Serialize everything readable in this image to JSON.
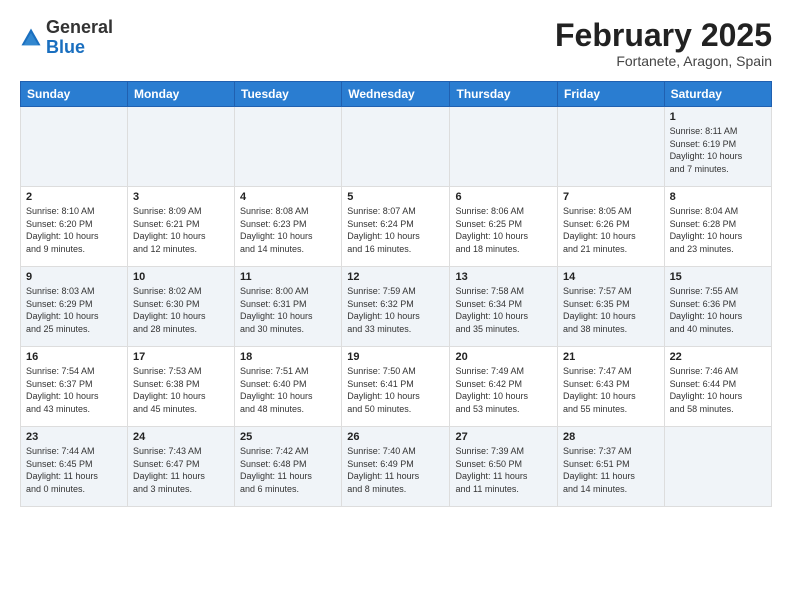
{
  "header": {
    "logo_general": "General",
    "logo_blue": "Blue",
    "title": "February 2025",
    "subtitle": "Fortanete, Aragon, Spain"
  },
  "weekdays": [
    "Sunday",
    "Monday",
    "Tuesday",
    "Wednesday",
    "Thursday",
    "Friday",
    "Saturday"
  ],
  "weeks": [
    [
      {
        "day": "",
        "info": ""
      },
      {
        "day": "",
        "info": ""
      },
      {
        "day": "",
        "info": ""
      },
      {
        "day": "",
        "info": ""
      },
      {
        "day": "",
        "info": ""
      },
      {
        "day": "",
        "info": ""
      },
      {
        "day": "1",
        "info": "Sunrise: 8:11 AM\nSunset: 6:19 PM\nDaylight: 10 hours\nand 7 minutes."
      }
    ],
    [
      {
        "day": "2",
        "info": "Sunrise: 8:10 AM\nSunset: 6:20 PM\nDaylight: 10 hours\nand 9 minutes."
      },
      {
        "day": "3",
        "info": "Sunrise: 8:09 AM\nSunset: 6:21 PM\nDaylight: 10 hours\nand 12 minutes."
      },
      {
        "day": "4",
        "info": "Sunrise: 8:08 AM\nSunset: 6:23 PM\nDaylight: 10 hours\nand 14 minutes."
      },
      {
        "day": "5",
        "info": "Sunrise: 8:07 AM\nSunset: 6:24 PM\nDaylight: 10 hours\nand 16 minutes."
      },
      {
        "day": "6",
        "info": "Sunrise: 8:06 AM\nSunset: 6:25 PM\nDaylight: 10 hours\nand 18 minutes."
      },
      {
        "day": "7",
        "info": "Sunrise: 8:05 AM\nSunset: 6:26 PM\nDaylight: 10 hours\nand 21 minutes."
      },
      {
        "day": "8",
        "info": "Sunrise: 8:04 AM\nSunset: 6:28 PM\nDaylight: 10 hours\nand 23 minutes."
      }
    ],
    [
      {
        "day": "9",
        "info": "Sunrise: 8:03 AM\nSunset: 6:29 PM\nDaylight: 10 hours\nand 25 minutes."
      },
      {
        "day": "10",
        "info": "Sunrise: 8:02 AM\nSunset: 6:30 PM\nDaylight: 10 hours\nand 28 minutes."
      },
      {
        "day": "11",
        "info": "Sunrise: 8:00 AM\nSunset: 6:31 PM\nDaylight: 10 hours\nand 30 minutes."
      },
      {
        "day": "12",
        "info": "Sunrise: 7:59 AM\nSunset: 6:32 PM\nDaylight: 10 hours\nand 33 minutes."
      },
      {
        "day": "13",
        "info": "Sunrise: 7:58 AM\nSunset: 6:34 PM\nDaylight: 10 hours\nand 35 minutes."
      },
      {
        "day": "14",
        "info": "Sunrise: 7:57 AM\nSunset: 6:35 PM\nDaylight: 10 hours\nand 38 minutes."
      },
      {
        "day": "15",
        "info": "Sunrise: 7:55 AM\nSunset: 6:36 PM\nDaylight: 10 hours\nand 40 minutes."
      }
    ],
    [
      {
        "day": "16",
        "info": "Sunrise: 7:54 AM\nSunset: 6:37 PM\nDaylight: 10 hours\nand 43 minutes."
      },
      {
        "day": "17",
        "info": "Sunrise: 7:53 AM\nSunset: 6:38 PM\nDaylight: 10 hours\nand 45 minutes."
      },
      {
        "day": "18",
        "info": "Sunrise: 7:51 AM\nSunset: 6:40 PM\nDaylight: 10 hours\nand 48 minutes."
      },
      {
        "day": "19",
        "info": "Sunrise: 7:50 AM\nSunset: 6:41 PM\nDaylight: 10 hours\nand 50 minutes."
      },
      {
        "day": "20",
        "info": "Sunrise: 7:49 AM\nSunset: 6:42 PM\nDaylight: 10 hours\nand 53 minutes."
      },
      {
        "day": "21",
        "info": "Sunrise: 7:47 AM\nSunset: 6:43 PM\nDaylight: 10 hours\nand 55 minutes."
      },
      {
        "day": "22",
        "info": "Sunrise: 7:46 AM\nSunset: 6:44 PM\nDaylight: 10 hours\nand 58 minutes."
      }
    ],
    [
      {
        "day": "23",
        "info": "Sunrise: 7:44 AM\nSunset: 6:45 PM\nDaylight: 11 hours\nand 0 minutes."
      },
      {
        "day": "24",
        "info": "Sunrise: 7:43 AM\nSunset: 6:47 PM\nDaylight: 11 hours\nand 3 minutes."
      },
      {
        "day": "25",
        "info": "Sunrise: 7:42 AM\nSunset: 6:48 PM\nDaylight: 11 hours\nand 6 minutes."
      },
      {
        "day": "26",
        "info": "Sunrise: 7:40 AM\nSunset: 6:49 PM\nDaylight: 11 hours\nand 8 minutes."
      },
      {
        "day": "27",
        "info": "Sunrise: 7:39 AM\nSunset: 6:50 PM\nDaylight: 11 hours\nand 11 minutes."
      },
      {
        "day": "28",
        "info": "Sunrise: 7:37 AM\nSunset: 6:51 PM\nDaylight: 11 hours\nand 14 minutes."
      },
      {
        "day": "",
        "info": ""
      }
    ]
  ]
}
